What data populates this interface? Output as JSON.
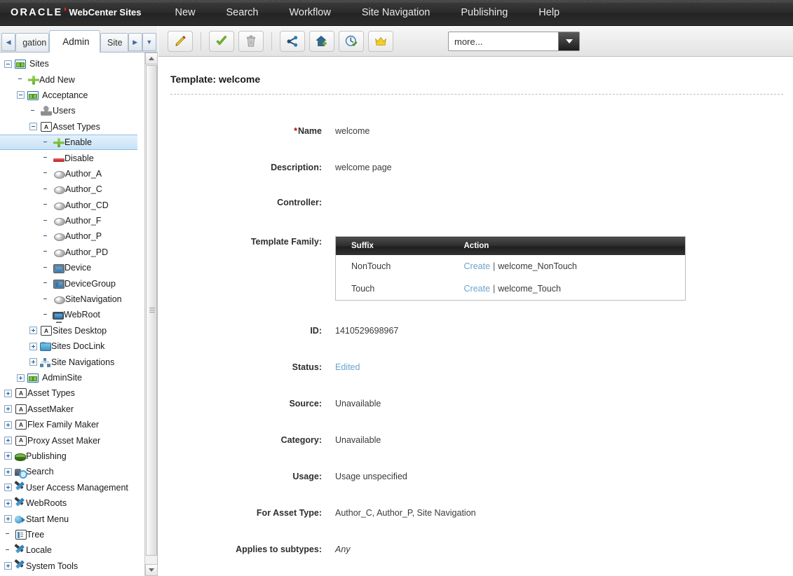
{
  "topnav": {
    "logo": "ORACLE",
    "product": "WebCenter Sites",
    "items": [
      {
        "label": "New",
        "name": "nav-new"
      },
      {
        "label": "Search",
        "name": "nav-search"
      },
      {
        "label": "Workflow",
        "name": "nav-workflow"
      },
      {
        "label": "Site Navigation",
        "name": "nav-site-navigation"
      },
      {
        "label": "Publishing",
        "name": "nav-publishing"
      },
      {
        "label": "Help",
        "name": "nav-help"
      }
    ]
  },
  "tabs": {
    "prev_arrow": "◀",
    "next_arrow": "▶",
    "dropdown_arrow": "▼",
    "items": [
      {
        "label": "gation",
        "active": false
      },
      {
        "label": "Admin",
        "active": true
      },
      {
        "label": "Site",
        "active": false
      }
    ]
  },
  "toolbar": {
    "buttons": [
      {
        "name": "edit-button",
        "icon": "pencil-icon",
        "label": "Edit"
      },
      {
        "name": "approve-button",
        "icon": "checkmark-icon",
        "label": "Approve"
      },
      {
        "name": "delete-button",
        "icon": "trash-icon",
        "label": "Delete"
      },
      {
        "name": "share-button",
        "icon": "share-icon",
        "label": "Share"
      },
      {
        "name": "add-to-site-button",
        "icon": "house-plus-icon",
        "label": "Add to Site"
      },
      {
        "name": "schedule-button",
        "icon": "clock-check-icon",
        "label": "Schedule"
      },
      {
        "name": "bookmark-button",
        "icon": "crown-icon",
        "label": "Bookmark"
      }
    ],
    "more_select": {
      "value": "more...",
      "placeholder": "more..."
    }
  },
  "tree": {
    "items": [
      {
        "label": "Sites",
        "indent": 0,
        "expander": "minus",
        "icon": "ico-site",
        "selected": false
      },
      {
        "label": "Add New",
        "indent": 1,
        "expander": "none",
        "icon": "ico-plus",
        "selected": false
      },
      {
        "label": "Acceptance",
        "indent": 1,
        "expander": "minus",
        "icon": "ico-site",
        "selected": false
      },
      {
        "label": "Users",
        "indent": 2,
        "expander": "none",
        "icon": "ico-users",
        "selected": false
      },
      {
        "label": "Asset Types",
        "indent": 2,
        "expander": "minus",
        "icon": "ico-assettype",
        "selected": false
      },
      {
        "label": "Enable",
        "indent": 3,
        "expander": "none",
        "icon": "ico-plus",
        "selected": true
      },
      {
        "label": "Disable",
        "indent": 3,
        "expander": "none",
        "icon": "ico-minus",
        "selected": false
      },
      {
        "label": "Author_A",
        "indent": 3,
        "expander": "none",
        "icon": "ico-ball",
        "selected": false
      },
      {
        "label": "Author_C",
        "indent": 3,
        "expander": "none",
        "icon": "ico-ball",
        "selected": false
      },
      {
        "label": "Author_CD",
        "indent": 3,
        "expander": "none",
        "icon": "ico-ball",
        "selected": false
      },
      {
        "label": "Author_F",
        "indent": 3,
        "expander": "none",
        "icon": "ico-ball",
        "selected": false
      },
      {
        "label": "Author_P",
        "indent": 3,
        "expander": "none",
        "icon": "ico-ball",
        "selected": false
      },
      {
        "label": "Author_PD",
        "indent": 3,
        "expander": "none",
        "icon": "ico-ball",
        "selected": false
      },
      {
        "label": "Device",
        "indent": 3,
        "expander": "none",
        "icon": "ico-device",
        "selected": false
      },
      {
        "label": "DeviceGroup",
        "indent": 3,
        "expander": "none",
        "icon": "ico-devgroup",
        "selected": false
      },
      {
        "label": "SiteNavigation",
        "indent": 3,
        "expander": "none",
        "icon": "ico-ball",
        "selected": false
      },
      {
        "label": "WebRoot",
        "indent": 3,
        "expander": "none",
        "icon": "ico-webroot",
        "selected": false
      },
      {
        "label": "Sites Desktop",
        "indent": 2,
        "expander": "plus",
        "icon": "ico-assettype",
        "selected": false
      },
      {
        "label": "Sites DocLink",
        "indent": 2,
        "expander": "plus",
        "icon": "ico-folder",
        "selected": false
      },
      {
        "label": "Site Navigations",
        "indent": 2,
        "expander": "plus",
        "icon": "ico-sitenav",
        "selected": false
      },
      {
        "label": "AdminSite",
        "indent": 1,
        "expander": "plus",
        "icon": "ico-site",
        "selected": false
      },
      {
        "label": "Asset Types",
        "indent": 0,
        "expander": "plus",
        "icon": "ico-assettype",
        "selected": false
      },
      {
        "label": "AssetMaker",
        "indent": 0,
        "expander": "plus",
        "icon": "ico-assettype",
        "selected": false
      },
      {
        "label": "Flex Family Maker",
        "indent": 0,
        "expander": "plus",
        "icon": "ico-assettype",
        "selected": false
      },
      {
        "label": "Proxy Asset Maker",
        "indent": 0,
        "expander": "plus",
        "icon": "ico-assettype",
        "selected": false
      },
      {
        "label": "Publishing",
        "indent": 0,
        "expander": "plus",
        "icon": "ico-publishing",
        "selected": false
      },
      {
        "label": "Search",
        "indent": 0,
        "expander": "plus",
        "icon": "ico-search",
        "selected": false
      },
      {
        "label": "User Access Management",
        "indent": 0,
        "expander": "plus",
        "icon": "ico-tools",
        "selected": false
      },
      {
        "label": "WebRoots",
        "indent": 0,
        "expander": "plus",
        "icon": "ico-tools",
        "selected": false
      },
      {
        "label": "Start Menu",
        "indent": 0,
        "expander": "plus",
        "icon": "ico-startmenu",
        "selected": false
      },
      {
        "label": "Tree",
        "indent": 0,
        "expander": "none",
        "icon": "ico-tree",
        "selected": false
      },
      {
        "label": "Locale",
        "indent": 0,
        "expander": "none",
        "icon": "ico-tools",
        "selected": false
      },
      {
        "label": "System Tools",
        "indent": 0,
        "expander": "plus",
        "icon": "ico-tools",
        "selected": false
      }
    ]
  },
  "main": {
    "page_title": "Template: welcome",
    "fields": [
      {
        "label": "Name",
        "required": true,
        "value": "welcome",
        "style": "plain"
      },
      {
        "label": "Description:",
        "required": false,
        "value": "welcome page",
        "style": "plain"
      },
      {
        "label": "Controller:",
        "required": false,
        "value": "",
        "style": "plain"
      },
      {
        "label": "ID:",
        "required": false,
        "value": "1410529698967",
        "style": "plain"
      },
      {
        "label": "Status:",
        "required": false,
        "value": "Edited",
        "style": "link"
      },
      {
        "label": "Source:",
        "required": false,
        "value": "Unavailable",
        "style": "plain"
      },
      {
        "label": "Category:",
        "required": false,
        "value": "Unavailable",
        "style": "plain"
      },
      {
        "label": "Usage:",
        "required": false,
        "value": "Usage unspecified",
        "style": "plain"
      },
      {
        "label": "For Asset Type:",
        "required": false,
        "value": "Author_C, Author_P, Site Navigation",
        "style": "plain"
      },
      {
        "label": "Applies to subtypes:",
        "required": false,
        "value": "Any",
        "style": "italic"
      }
    ],
    "template_family": {
      "label": "Template Family:",
      "columns": [
        "Suffix",
        "Action"
      ],
      "rows": [
        {
          "suffix": "NonTouch",
          "action_link": "Create",
          "separator": "|",
          "action_text": "welcome_NonTouch"
        },
        {
          "suffix": "Touch",
          "action_link": "Create",
          "separator": "|",
          "action_text": "welcome_Touch"
        }
      ]
    }
  },
  "colors": {
    "accent_link": "#6aa3cf",
    "required_star": "#c00000",
    "topbar_bg": "#2b2b2b",
    "selection_bg": "#c7e2f6"
  }
}
